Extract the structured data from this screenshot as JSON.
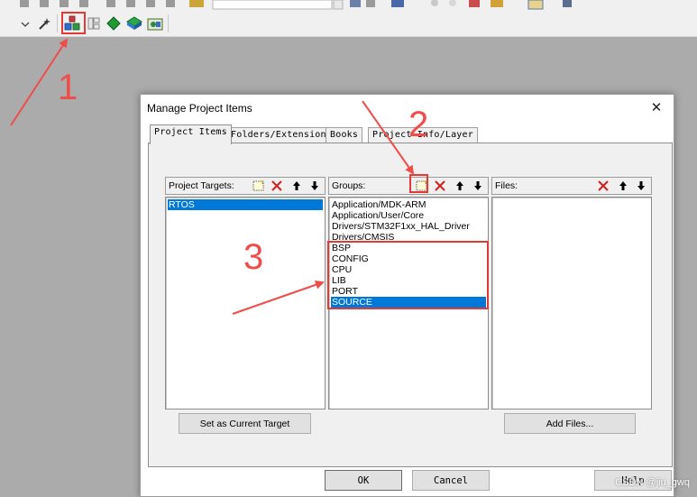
{
  "dialog": {
    "title": "Manage Project Items",
    "close_glyph": "✕",
    "tabs": [
      {
        "label": "Project Items"
      },
      {
        "label": "Folders/Extensions"
      },
      {
        "label": "Books"
      },
      {
        "label": "Project Info/Layer"
      }
    ],
    "targets": {
      "label": "Project Targets:",
      "items": [
        "RTOS"
      ],
      "selected_index": 0
    },
    "groups": {
      "label": "Groups:",
      "items": [
        "Application/MDK-ARM",
        "Application/User/Core",
        "Drivers/STM32F1xx_HAL_Driver",
        "Drivers/CMSIS",
        "BSP",
        "CONFIG",
        "CPU",
        "LIB",
        "PORT",
        "SOURCE"
      ],
      "selected_index": 9
    },
    "files": {
      "label": "Files:",
      "items": []
    },
    "buttons": {
      "set_current_target": "Set as Current Target",
      "add_files": "Add Files...",
      "ok": "OK",
      "cancel": "Cancel",
      "help": "Help"
    }
  },
  "annotations": {
    "label_1": "1",
    "label_2": "2",
    "label_3": "3",
    "color": "#e53935"
  },
  "watermark": "CSDN @jiu_gwq",
  "icons": {
    "new": "new-item-icon",
    "delete": "delete-icon",
    "move_up": "arrow-up-icon",
    "move_down": "arrow-down-icon"
  }
}
